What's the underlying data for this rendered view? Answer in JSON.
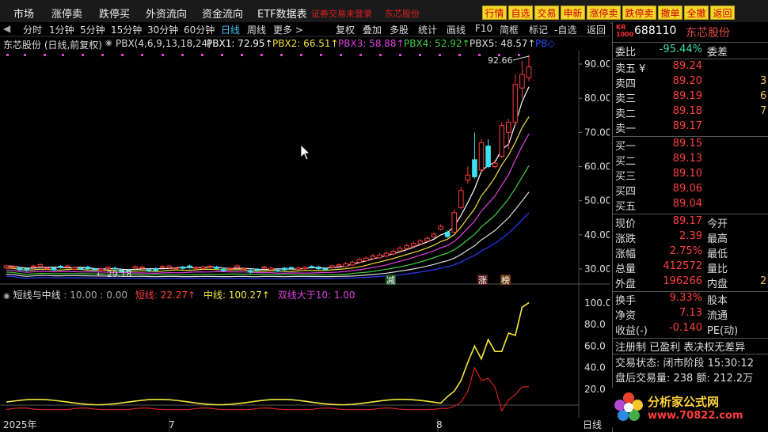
{
  "topbar": {
    "menus": [
      "市场",
      "涨停卖",
      "跌停买",
      "外资流向",
      "资金流向",
      "ETF数据表"
    ],
    "login_warning": "证券交易未登录",
    "stock_name": "东芯股份",
    "buttons": [
      "行情",
      "自选",
      "交易",
      "申新",
      "涨停卖",
      "跌停卖",
      "撤单",
      "全撤",
      "返回"
    ]
  },
  "period_bar": {
    "items": [
      "分时",
      "1分钟",
      "5分钟",
      "15分钟",
      "30分钟",
      "60分钟",
      "日线",
      "周线",
      "更多 >"
    ],
    "active": "日线",
    "tools": [
      "复权",
      "叠加",
      "多股",
      "统计",
      "画线",
      "F10",
      "简框",
      "标记",
      "-自选",
      "返回"
    ]
  },
  "indicator": {
    "title": "东芯股份 (日线,前复权)",
    "params": "PBX(4,6,9,13,18,24)",
    "pbx1": "PBX1: 72.95↑",
    "pbx2": "PBX2: 66.51↑",
    "pbx3": "PBX3: 58.88↑",
    "pbx4": "PBX4: 52.92↑",
    "pbx5": "PBX5: 48.57↑",
    "pbx6": "PB◇"
  },
  "chart_labels": {
    "high_price": "92.66",
    "low_price": "← 29.18",
    "y_ticks": [
      "90.00",
      "80.00",
      "70.00",
      "60.00",
      "50.00",
      "40.00",
      "30.00"
    ],
    "sub_y_ticks": [
      "100.0",
      "80.0",
      "60.0",
      "40.0",
      "20.0"
    ],
    "x_labels": [
      "2025年",
      "7",
      "8"
    ],
    "axis_type": "日线",
    "markers": [
      "减",
      "涨",
      "榜"
    ]
  },
  "sub_indicator": {
    "name": "短线与中线",
    "params": ": 10.00 : 0.00",
    "short": "短线: 22.27↑",
    "mid": "中线: 100.27↑",
    "double": "双线大于10: 1.00"
  },
  "right_panel": {
    "badge_top": "KR",
    "badge_bottom": "1000",
    "code": "688110",
    "name": "东芯股份",
    "weibi_label": "委比",
    "weibi_value": "-95.44%",
    "weicha_label": "委差",
    "asks": [
      {
        "label": "卖五 ¥",
        "price": "89.24",
        "edge": ""
      },
      {
        "label": "卖四",
        "price": "89.20",
        "edge": "3"
      },
      {
        "label": "卖三",
        "price": "89.19",
        "edge": "6"
      },
      {
        "label": "卖二",
        "price": "89.18",
        "edge": "7"
      },
      {
        "label": "卖一",
        "price": "89.17",
        "edge": ""
      }
    ],
    "bids": [
      {
        "label": "买一",
        "price": "89.15"
      },
      {
        "label": "买二",
        "price": "89.13"
      },
      {
        "label": "买三",
        "price": "89.10"
      },
      {
        "label": "买四",
        "price": "89.06"
      },
      {
        "label": "买五",
        "price": "89.04"
      }
    ],
    "stats": [
      {
        "label": "现价",
        "value": "89.17",
        "label2": "今开"
      },
      {
        "label": "涨跌",
        "value": "2.39",
        "label2": "最高"
      },
      {
        "label": "涨幅",
        "value": "2.75%",
        "label2": "最低"
      },
      {
        "label": "总量",
        "value": "412572",
        "label2": "量比"
      },
      {
        "label": "外盘",
        "value": "196266",
        "label2": "内盘",
        "edge": "2"
      }
    ],
    "stats2": [
      {
        "label": "换手",
        "value": "9.33%",
        "label2": "股本"
      },
      {
        "label": "净资",
        "value": "7.13",
        "label2": "流通"
      },
      {
        "label": "收益(-)",
        "value": "-0.140",
        "label2": "PE(动)"
      }
    ],
    "tags": "注册制 已盈利 表决权无差异",
    "trade_status": "交易状态: 闭市阶段 15:30:12",
    "after_hours": "盘后交易量: 238  额: 212.2万"
  },
  "watermark": {
    "text": "分析家公式网",
    "url": "www.70822.com"
  },
  "colors": {
    "up": "#ff3b3b",
    "down": "#3fe0f0",
    "pbx1": "#ffffff",
    "pbx2": "#f3e03a",
    "pbx3": "#e040e0",
    "pbx4": "#40d040",
    "pbx5": "#dddddd",
    "pbx6": "#2040ff"
  }
}
